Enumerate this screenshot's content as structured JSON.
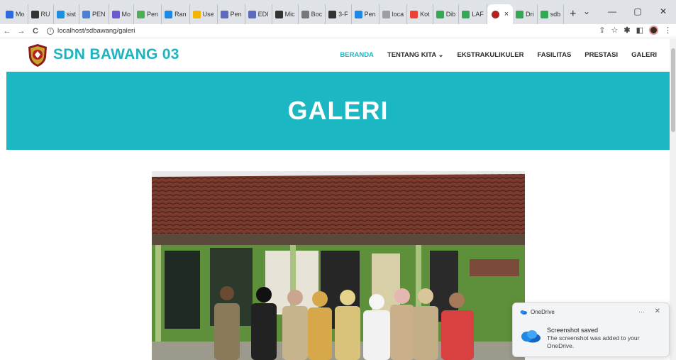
{
  "browser": {
    "tabs": [
      {
        "label": "Mo",
        "color": "#2d6cdf"
      },
      {
        "label": "RU",
        "color": "#333333"
      },
      {
        "label": "sist",
        "color": "#1d8fe0"
      },
      {
        "label": "PEN",
        "color": "#4a7fd4"
      },
      {
        "label": "Mo",
        "color": "#6a5acd"
      },
      {
        "label": "Pen",
        "color": "#4caf50"
      },
      {
        "label": "Ran",
        "color": "#1e88e5"
      },
      {
        "label": "Use",
        "color": "#f4b400"
      },
      {
        "label": "Pen",
        "color": "#5c6bc0"
      },
      {
        "label": "EDI",
        "color": "#5c6bc0"
      },
      {
        "label": "Mic",
        "color": "#333333"
      },
      {
        "label": "Boc",
        "color": "#777777"
      },
      {
        "label": "3-F",
        "color": "#333333"
      },
      {
        "label": "Pen",
        "color": "#1e88e5"
      },
      {
        "label": "loca",
        "color": "#9e9e9e"
      },
      {
        "label": "Kot",
        "color": "#ea4335"
      },
      {
        "label": "Dib",
        "color": "#34a853"
      },
      {
        "label": "LAF",
        "color": "#34a853"
      }
    ],
    "active_tab": {
      "label": "",
      "close": "×"
    },
    "tabs_after": [
      {
        "label": "Dri",
        "color": "#34a853"
      },
      {
        "label": "sdb",
        "color": "#34a853"
      }
    ],
    "new_tab": "+",
    "window": {
      "chevron": "⌄",
      "minimize": "—",
      "restore": "▢",
      "close": "✕"
    },
    "nav": {
      "back": "←",
      "forward": "→",
      "reload": "C"
    },
    "url": "localhost/sdbawang/galeri"
  },
  "site": {
    "brand": "SDN BAWANG 03",
    "nav": [
      {
        "label": "BERANDA",
        "active": true
      },
      {
        "label": "TENTANG KITA ⌄",
        "active": false
      },
      {
        "label": "EKSTRAKULIKULER",
        "active": false
      },
      {
        "label": "FASILITAS",
        "active": false
      },
      {
        "label": "PRESTASI",
        "active": false
      },
      {
        "label": "GALERI",
        "active": false
      }
    ],
    "hero_title": "GALERI",
    "accent": "#1eb3bf"
  },
  "toast": {
    "app": "OneDrive",
    "more": "···",
    "close": "✕",
    "title": "Screenshot saved",
    "message": "The screenshot was added to your OneDrive."
  }
}
